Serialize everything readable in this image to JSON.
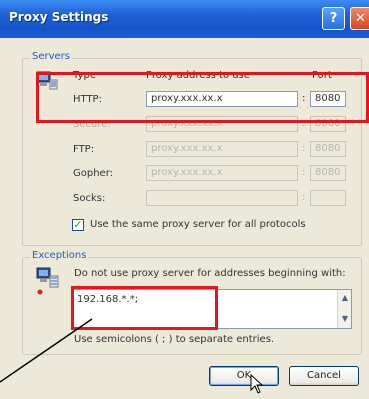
{
  "window": {
    "title": "Proxy Settings",
    "help_btn": "?",
    "close_btn": "✕"
  },
  "servers": {
    "group_label": "Servers",
    "col_type": "Type",
    "col_address": "Proxy address to use",
    "col_port": "Port",
    "rows": [
      {
        "type": "HTTP:",
        "address": "proxy.xxx.xx.x",
        "port": "8080",
        "enabled": true
      },
      {
        "type": "Secure:",
        "address": "proxy.xxx.xx.x",
        "port": "8080",
        "enabled": false
      },
      {
        "type": "FTP:",
        "address": "proxy.xxx.xx.x",
        "port": "8080",
        "enabled": false
      },
      {
        "type": "Gopher:",
        "address": "proxy.xxx.xx.x",
        "port": "8080",
        "enabled": false
      },
      {
        "type": "Socks:",
        "address": "",
        "port": "",
        "enabled": false
      }
    ],
    "same_proxy_label": "Use the same proxy server for all protocols",
    "same_proxy_checked": true
  },
  "exceptions": {
    "group_label": "Exceptions",
    "instruction": "Do not use proxy server for addresses beginning with:",
    "value": "192.168.*.*;",
    "help_text": "Use semicolons ( ; ) to separate entries."
  },
  "buttons": {
    "ok": "OK",
    "cancel": "Cancel"
  },
  "colors": {
    "highlight": "#e2161e",
    "titlebar": "#1f64d9"
  }
}
